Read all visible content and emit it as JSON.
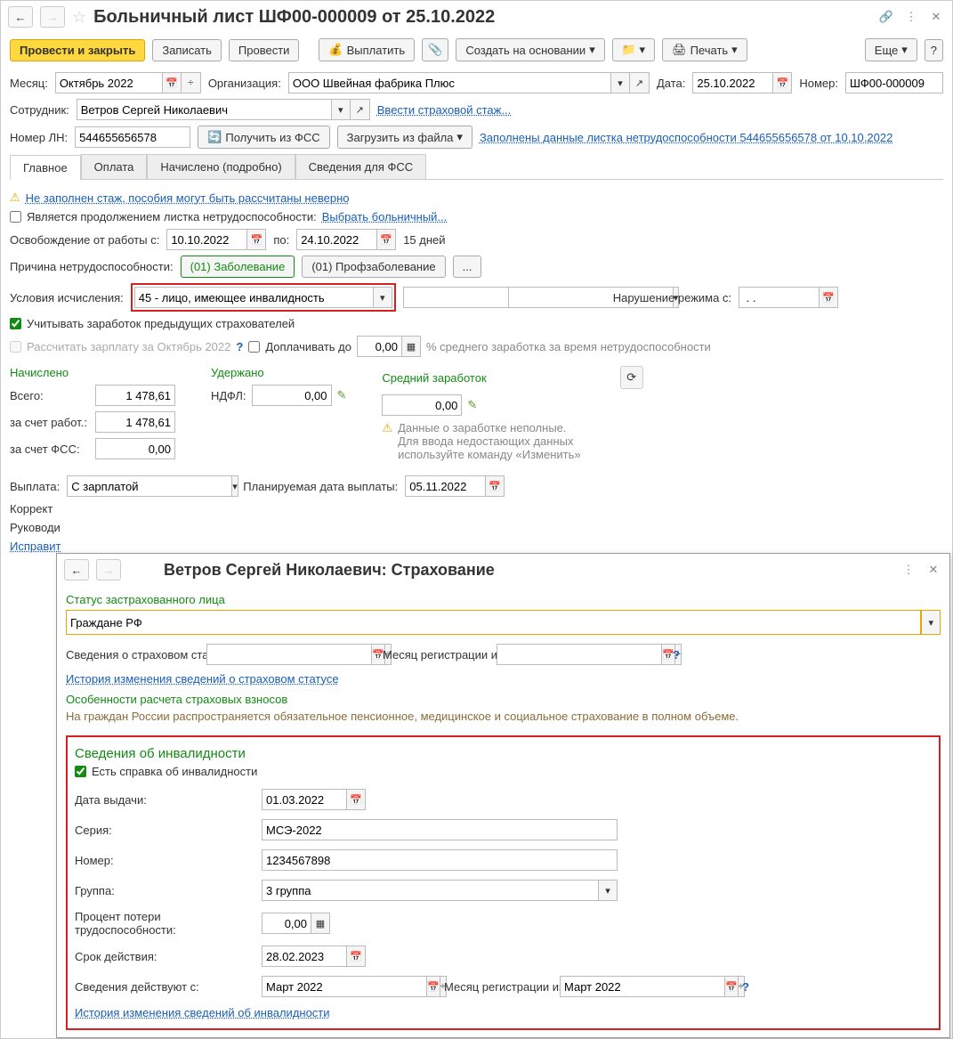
{
  "title": "Больничный лист ШФ00-000009 от 25.10.2022",
  "toolbar": {
    "post_close": "Провести и закрыть",
    "save": "Записать",
    "post": "Провести",
    "pay": "Выплатить",
    "create_base": "Создать на основании",
    "print": "Печать",
    "more": "Еще"
  },
  "header": {
    "month_label": "Месяц:",
    "month_value": "Октябрь 2022",
    "org_label": "Организация:",
    "org_value": "ООО Швейная фабрика Плюс",
    "date_label": "Дата:",
    "date_value": "25.10.2022",
    "num_label": "Номер:",
    "num_value": "ШФ00-000009",
    "employee_label": "Сотрудник:",
    "employee_value": "Ветров Сергей Николаевич",
    "insurance_link": "Ввести страховой стаж...",
    "ln_label": "Номер ЛН:",
    "ln_value": "544655656578",
    "get_fss": "Получить из ФСС",
    "load_file": "Загрузить из файла",
    "data_link": "Заполнены данные листка нетрудоспособности 544655656578 от 10.10.2022"
  },
  "tabs": {
    "main": "Главное",
    "pay": "Оплата",
    "accrued": "Начислено (подробно)",
    "fss": "Сведения для ФСС"
  },
  "main_tab": {
    "warn_text": "Не заполнен стаж, пособия могут быть рассчитаны неверно",
    "is_continuation": "Является продолжением листка нетрудоспособности:",
    "select_sick": "Выбрать больничный...",
    "release_from": "Освобождение от работы с:",
    "release_from_val": "10.10.2022",
    "release_to": "по:",
    "release_to_val": "24.10.2022",
    "days": "15 дней",
    "reason_label": "Причина нетрудоспособности:",
    "reason1": "(01) Заболевание",
    "reason2": "(01) Профзаболевание",
    "reason_more": "...",
    "calc_cond_label": "Условия исчисления:",
    "calc_cond_val": "45 - лицо, имеющее инвалидность",
    "violation_label": "Нарушение режима с:",
    "violation_val": " . .",
    "prev_earnings": "Учитывать заработок предыдущих страхователей",
    "recalc_salary": "Рассчитать зарплату за Октябрь 2022",
    "topup_label": "Доплачивать до",
    "topup_val": "0,00",
    "topup_suffix": "% среднего заработка за время нетрудоспособности",
    "accrued_h": "Начислено",
    "withheld_h": "Удержано",
    "avg_h": "Средний заработок",
    "total_label": "Всего:",
    "total_val": "1 478,61",
    "ndfl_label": "НДФЛ:",
    "ndfl_val": "0,00",
    "avg_val": "0,00",
    "employer_label": "за счет работ.:",
    "employer_val": "1 478,61",
    "fss_label": "за счет ФСС:",
    "fss_val": "0,00",
    "warn2_l1": "Данные о заработке неполные.",
    "warn2_l2": "Для ввода недостающих данных",
    "warn2_l3": "используйте команду «Изменить»",
    "payout_label": "Выплата:",
    "payout_val": "С зарплатой",
    "plan_date_label": "Планируемая дата выплаты:",
    "plan_date_val": "05.11.2022",
    "correct_label": "Коррект",
    "manager_label": "Руководи",
    "fix_link": "Исправит"
  },
  "modal": {
    "title": "Ветров Сергей Николаевич: Страхование",
    "status_h": "Статус застрахованного лица",
    "status_val": "Граждане РФ",
    "valid_from_label": "Сведения о страховом статусе действуют с:",
    "reg_month_label": "Месяц регистрации изменений:",
    "history_status_link": "История изменения сведений о страховом статусе",
    "features_h": "Особенности расчета страховых взносов",
    "features_text": "На граждан России распространяется обязательное пенсионное, медицинское и социальное страхование в полном объеме.",
    "dis_h": "Сведения об инвалидности",
    "dis_check": "Есть справка об инвалидности",
    "dis_date_label": "Дата выдачи:",
    "dis_date_val": "01.03.2022",
    "dis_series_label": "Серия:",
    "dis_series_val": "МСЭ-2022",
    "dis_num_label": "Номер:",
    "dis_num_val": "1234567898",
    "dis_group_label": "Группа:",
    "dis_group_val": "3 группа",
    "dis_pct_label": "Процент потери трудоспособности:",
    "dis_pct_val": "0,00",
    "dis_term_label": "Срок действия:",
    "dis_term_val": "28.02.2023",
    "dis_valid_label": "Сведения действуют с:",
    "dis_valid_val": "Март 2022",
    "dis_reg_label": "Месяц регистрации изменений:",
    "dis_reg_val": "Март 2022",
    "dis_history_link": "История изменения сведений об инвалидности"
  }
}
